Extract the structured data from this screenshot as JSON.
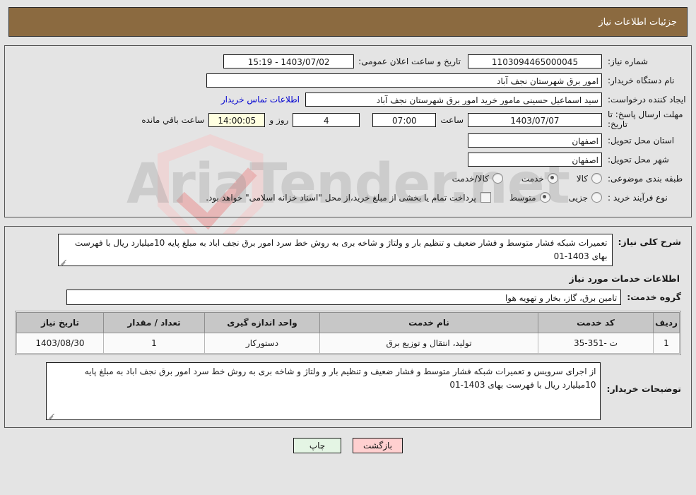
{
  "header": {
    "title": "جزئیات اطلاعات نیاز"
  },
  "colors": {
    "header_bar": "#8b6a40",
    "link": "#0000d0",
    "back_button": "#ffd0d0",
    "print_button": "#e4f5e4",
    "countdown_field": "#ffffe0",
    "table_header": "#c7c7c7"
  },
  "watermark": {
    "text": "AriaTender.net"
  },
  "form": {
    "need_number": {
      "label": "شماره نیاز:",
      "value": "1103094465000045"
    },
    "public_announcement": {
      "label": "تاریخ و ساعت اعلان عمومی:",
      "value": "1403/07/02 - 15:19"
    },
    "buyer_org": {
      "label": "نام دستگاه خریدار:",
      "value": "امور برق شهرستان نجف آباد"
    },
    "request_creator": {
      "label": "ایجاد کننده درخواست:",
      "value": "سید اسماعیل  حسینی  مامور خرید  امور برق شهرستان نجف آباد"
    },
    "contact_link": {
      "label": "اطلاعات تماس خریدار"
    },
    "response_deadline": {
      "label": "مهلت ارسال پاسخ: تا تاریخ:",
      "date": "1403/07/07",
      "time_label": "ساعت",
      "time": "07:00",
      "days": "4",
      "days_label": "روز و",
      "remaining": "14:00:05",
      "remaining_label": "ساعت باقي مانده"
    },
    "delivery_province": {
      "label": "استان محل تحویل:",
      "value": "اصفهان"
    },
    "delivery_city": {
      "label": "شهر محل تحویل:",
      "value": "اصفهان"
    },
    "category": {
      "label": "طبقه بندی موضوعی:",
      "options": [
        {
          "label": "کالا",
          "selected": false
        },
        {
          "label": "خدمت",
          "selected": true
        },
        {
          "label": "کالا/خدمت",
          "selected": false
        }
      ]
    },
    "purchase_type": {
      "label": "نوع فرآیند خرید :",
      "options": [
        {
          "label": "جزیی",
          "selected": false
        },
        {
          "label": "متوسط",
          "selected": true
        }
      ],
      "checkbox_text": "پرداخت تمام یا بخشی از مبلغ خرید،از محل \"اسناد خزانه اسلامی\" خواهد بود.",
      "checkbox_checked": false
    }
  },
  "description": {
    "label": "شرح کلی نیاز:",
    "value": "تعمیرات شبکه فشار متوسط و فشار ضعیف  و تنظیم بار و ولتاژ و شاخه بری به روش خط سرد امور برق نجف اباد به مبلغ پایه 10میلیارد ریال با فهرست بهای 1403-01"
  },
  "services_section": {
    "title": "اطلاعات خدمات مورد نیاز",
    "service_group": {
      "label": "گروه خدمت:",
      "value": "تامین برق، گاز، بخار و تهویه هوا"
    },
    "table": {
      "columns": [
        "ردیف",
        "کد خدمت",
        "نام خدمت",
        "واحد اندازه گیری",
        "تعداد / مقدار",
        "تاریخ نیاز"
      ],
      "rows": [
        {
          "radif": "1",
          "code": "ت -351-35",
          "name": "تولید، انتقال و توزیع برق",
          "unit": "دستورکار",
          "qty": "1",
          "date": "1403/08/30"
        }
      ]
    }
  },
  "buyer_notes": {
    "label": "توضیحات خریدار:",
    "value": "از اجرای سرویس و تعمیرات شبکه فشار متوسط و فشار ضعیف  و تنظیم بار و ولتاژ و شاخه بری به روش خط سرد امور برق نجف اباد به مبلغ پایه 10میلیارد ریال با فهرست بهای 1403-01"
  },
  "footer": {
    "back_label": "بازگشت",
    "print_label": "چاپ"
  }
}
